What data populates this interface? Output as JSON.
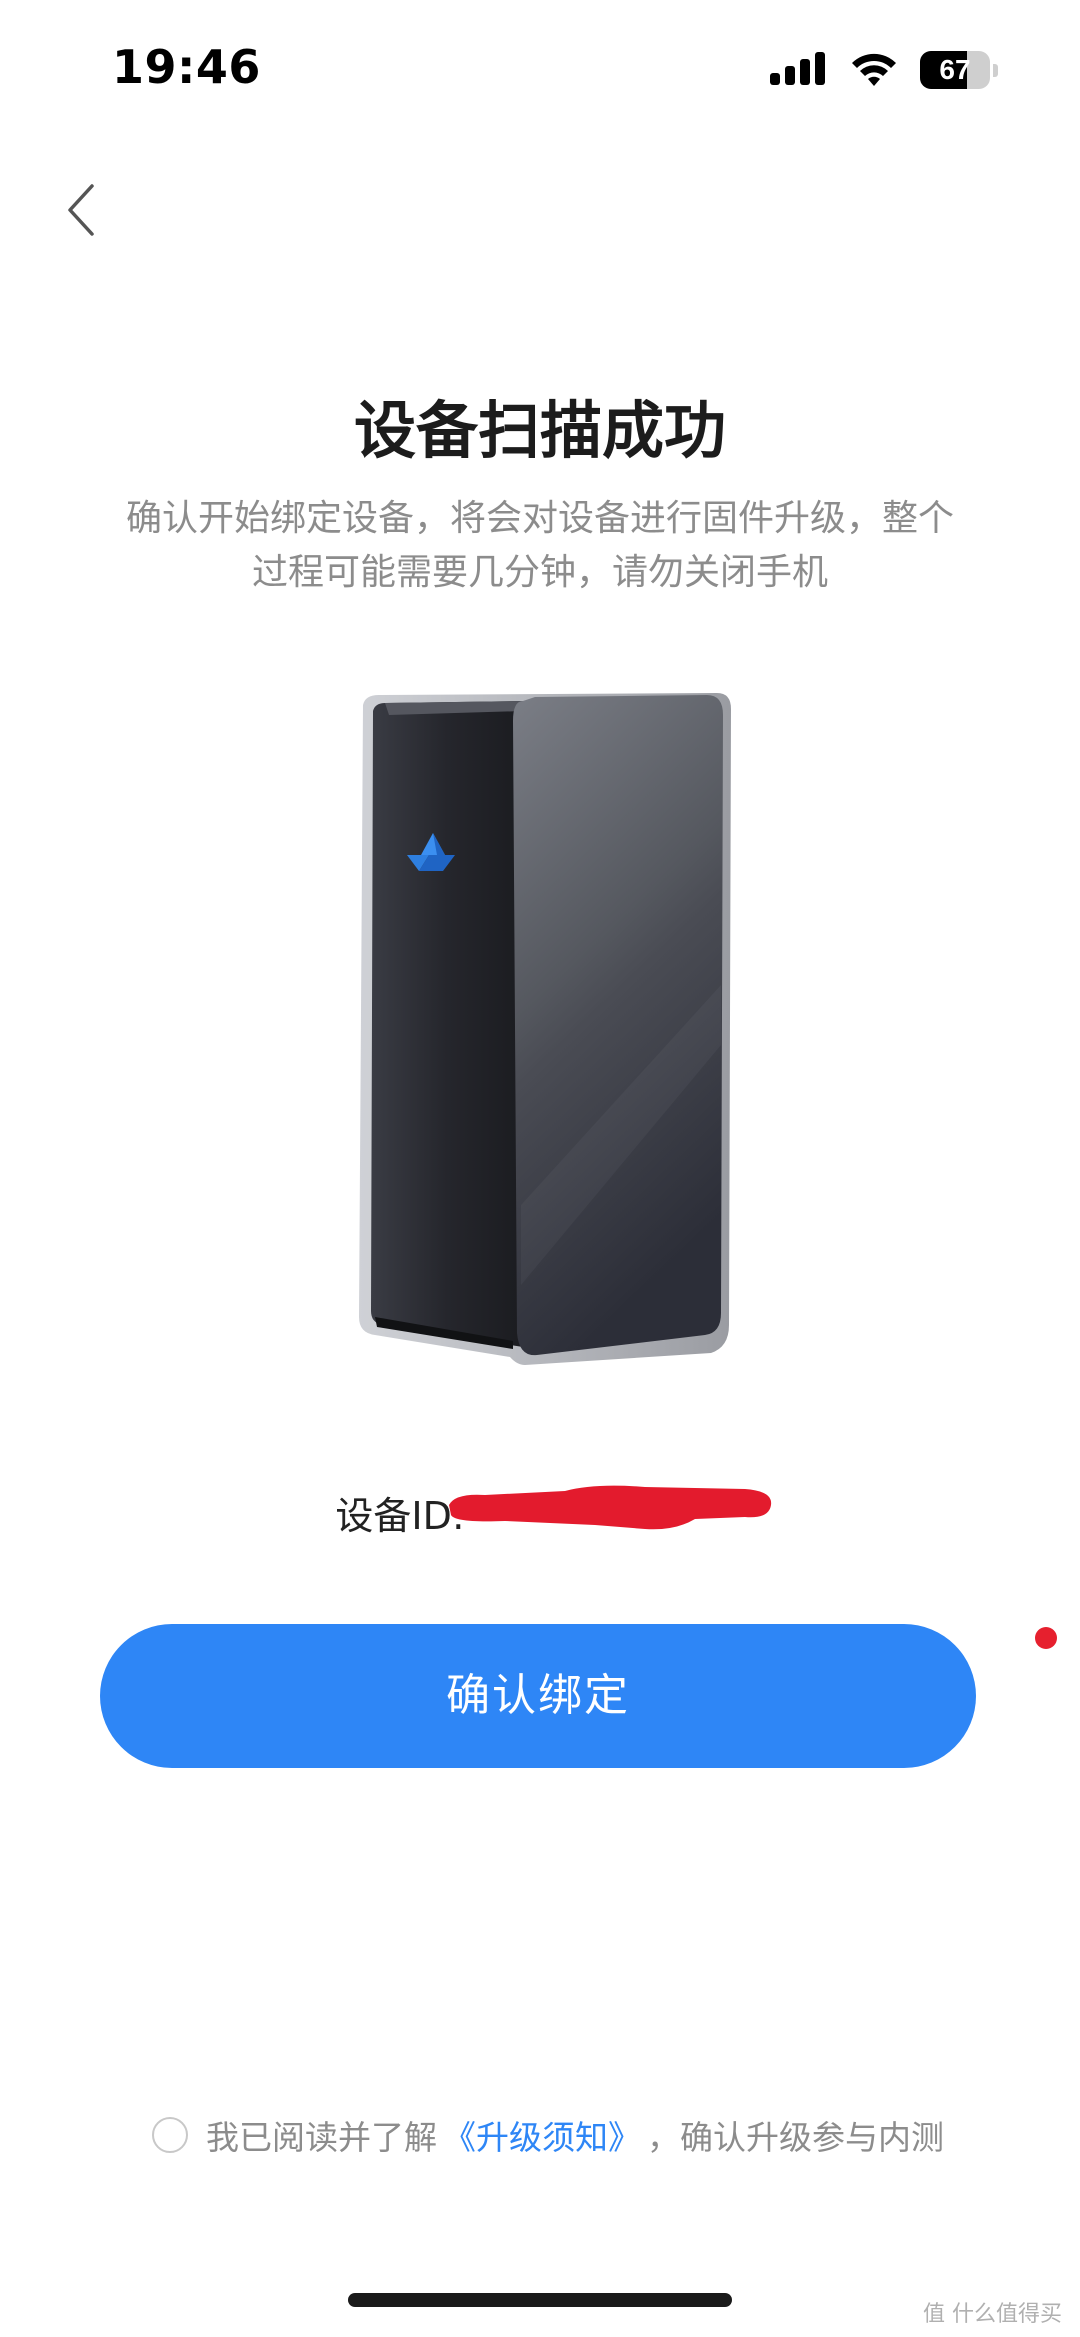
{
  "status_bar": {
    "time": "19:46",
    "battery_percent": "67",
    "battery_level": 0.67,
    "icons": [
      "signal-icon",
      "wifi-icon",
      "battery-icon"
    ]
  },
  "nav": {
    "back_icon": "chevron-left-icon"
  },
  "header": {
    "title": "设备扫描成功",
    "description_line1": "确认开始绑定设备，将会对设备进行固件升级，整个",
    "description_line2": "过程可能需要几分钟，请勿关闭手机"
  },
  "device": {
    "image": "nas-device-illustration",
    "id_label": "设备ID:"
  },
  "actions": {
    "confirm_label": "确认绑定"
  },
  "agreement": {
    "prefix": "我已阅读并了解",
    "link_text": "《升级须知》",
    "suffix": "，确认升级参与内测",
    "checked": false
  },
  "watermark": {
    "text": "值 什么值得买"
  },
  "colors": {
    "accent": "#2e86f6",
    "title": "#1c1c1c",
    "secondary_text": "#8c8c8c",
    "redaction": "#e31b2d",
    "background": "#ffffff"
  }
}
